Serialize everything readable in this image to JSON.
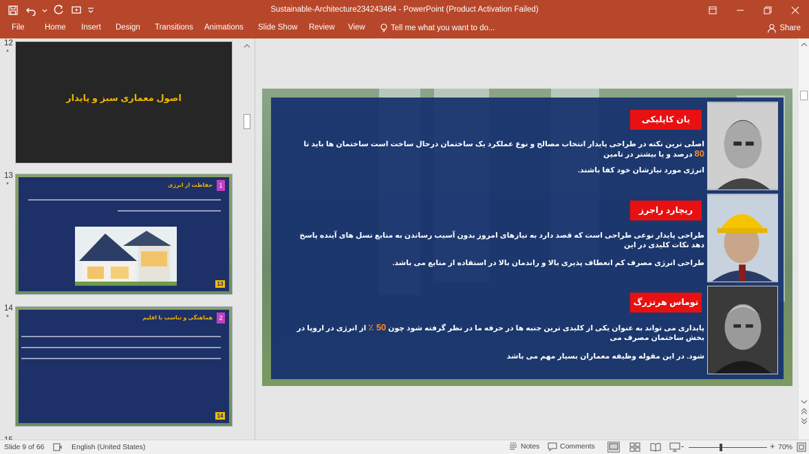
{
  "app": {
    "title": "Sustainable-Architecture234243464 - PowerPoint (Product Activation Failed)",
    "accent": "#b7472a"
  },
  "ribbon": {
    "file": "File",
    "tabs": [
      "Home",
      "Insert",
      "Design",
      "Transitions",
      "Animations",
      "Slide Show",
      "Review",
      "View"
    ],
    "tellme": "Tell me what you want to do...",
    "share": "Share"
  },
  "thumbnails": [
    {
      "number": "12",
      "star": "*",
      "title": "اصول معمارى سبز و پایدار"
    },
    {
      "number": "13",
      "star": "*",
      "title": "حفاظت از انرژی",
      "badge": "1",
      "badge_color": "#c040c0",
      "page": "13"
    },
    {
      "number": "14",
      "star": "*",
      "title": "هماهنگی و تناسب با اقلیم",
      "badge": "2",
      "badge_color": "#c040c0",
      "page": "14"
    },
    {
      "number": "15"
    }
  ],
  "slide": {
    "people": [
      {
        "name": "یان کاپلیکی",
        "line1_pre": "اصلی ترین نکته در طراحی پایدار انتخاب مصالح و نوع عملکرد یک ساختمان درحال ساخت است ساختمان ها باید تا",
        "line1_num": "80",
        "line1_post": "درصد و یا بیشتر در تامین",
        "line2": "انرژی مورد نیازشان خود کفا باشند."
      },
      {
        "name": "ریچارد راجرز",
        "line1": "طراحی پایدار نوعی طراحی است که قصد دارد به نیازهای امروز بدون آسیب رساندن به منابع نسل های آینده پاسخ دهد نکات کلیدی در این",
        "line2": "طراحی انرژی مصرف کم انعطاف پذیری بالا و راندمان بالا در استفاده از منابع می باشد."
      },
      {
        "name": "توماس هرتزرگ",
        "line1_pre": "پایداری می تواند به عنوان یکی از کلیدی ترین جنبه ها در حرفه ما در نظر گرفته شود چون",
        "line1_num": "50 ٪",
        "line1_post": "از انرژی در اروپا در بخش ساختمان مصرف می",
        "line2": "شود. در این مقوله وظیفه معماران بسیار مهم می باشد"
      }
    ],
    "name_badge_color": "#e81010",
    "panel_color": "#16306e",
    "highlight_color": "#ff8a1a"
  },
  "status": {
    "slide_info": "Slide 9 of 66",
    "language": "English (United States)",
    "notes": "Notes",
    "comments": "Comments",
    "zoom_minus": "-",
    "zoom_plus": "+",
    "zoom": "70%"
  }
}
